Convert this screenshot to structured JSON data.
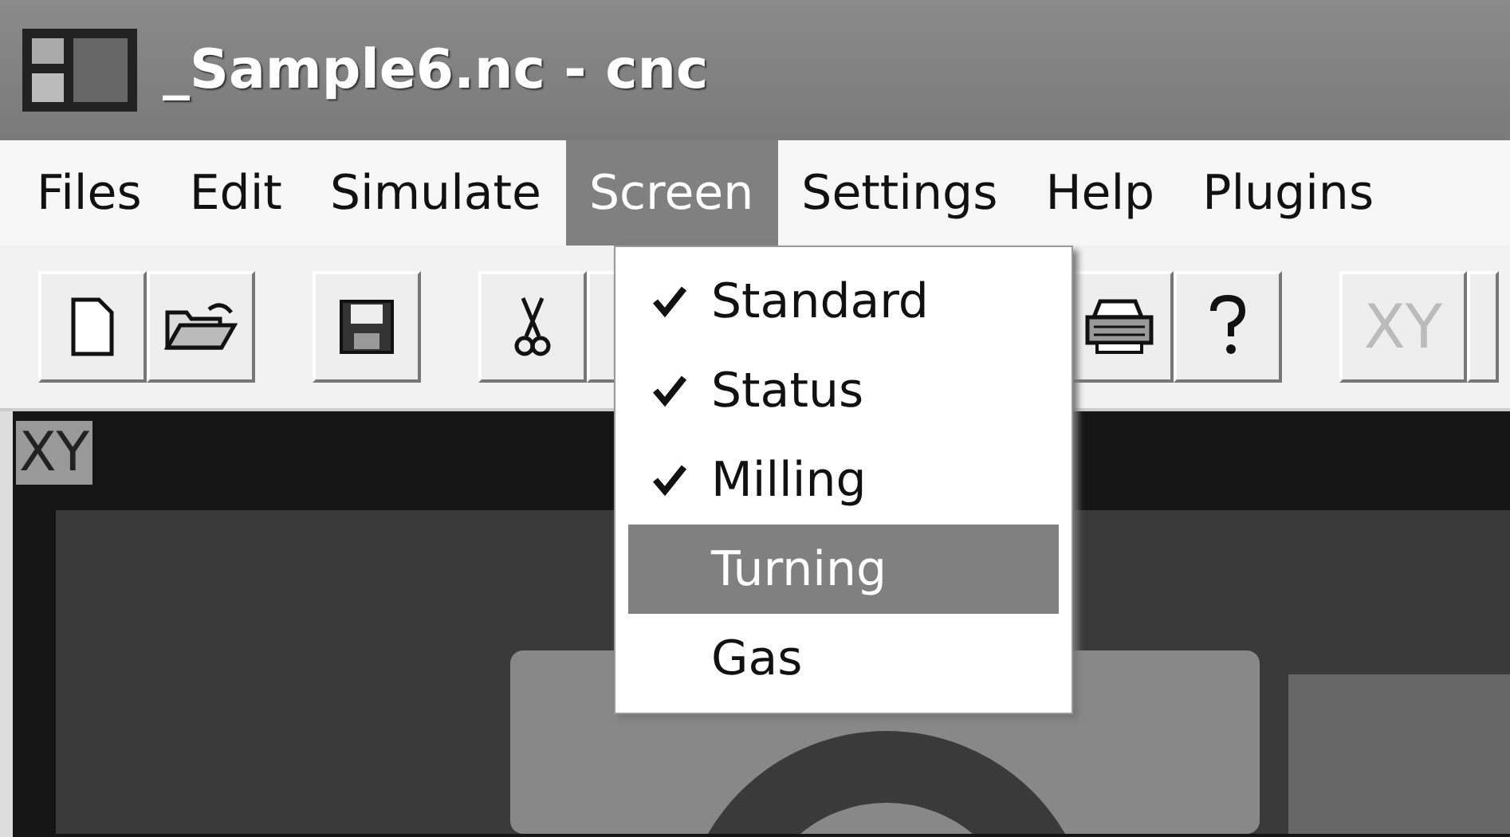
{
  "window": {
    "title": "_Sample6.nc - cnc"
  },
  "menu_bar": [
    {
      "label": "Files",
      "selected": false
    },
    {
      "label": "Edit",
      "selected": false
    },
    {
      "label": "Simulate",
      "selected": false
    },
    {
      "label": "Screen",
      "selected": true
    },
    {
      "label": "Settings",
      "selected": false
    },
    {
      "label": "Help",
      "selected": false
    },
    {
      "label": "Plugins",
      "selected": false
    }
  ],
  "toolbar": [
    {
      "kind": "new"
    },
    {
      "kind": "open"
    },
    {
      "kind": "gap"
    },
    {
      "kind": "save"
    },
    {
      "kind": "gap"
    },
    {
      "kind": "cut"
    },
    {
      "kind": "hidden"
    },
    {
      "kind": "print"
    },
    {
      "kind": "help"
    },
    {
      "kind": "gap"
    },
    {
      "kind": "text",
      "label": "XY",
      "disabled": true
    },
    {
      "kind": "edge"
    }
  ],
  "screen_menu": [
    {
      "label": "Standard",
      "checked": true,
      "selected": false
    },
    {
      "label": "Status",
      "checked": true,
      "selected": false
    },
    {
      "label": "Milling",
      "checked": true,
      "selected": false
    },
    {
      "label": "Turning",
      "checked": false,
      "selected": true
    },
    {
      "label": "Gas",
      "checked": false,
      "selected": false
    }
  ],
  "view": {
    "label": "XY"
  }
}
